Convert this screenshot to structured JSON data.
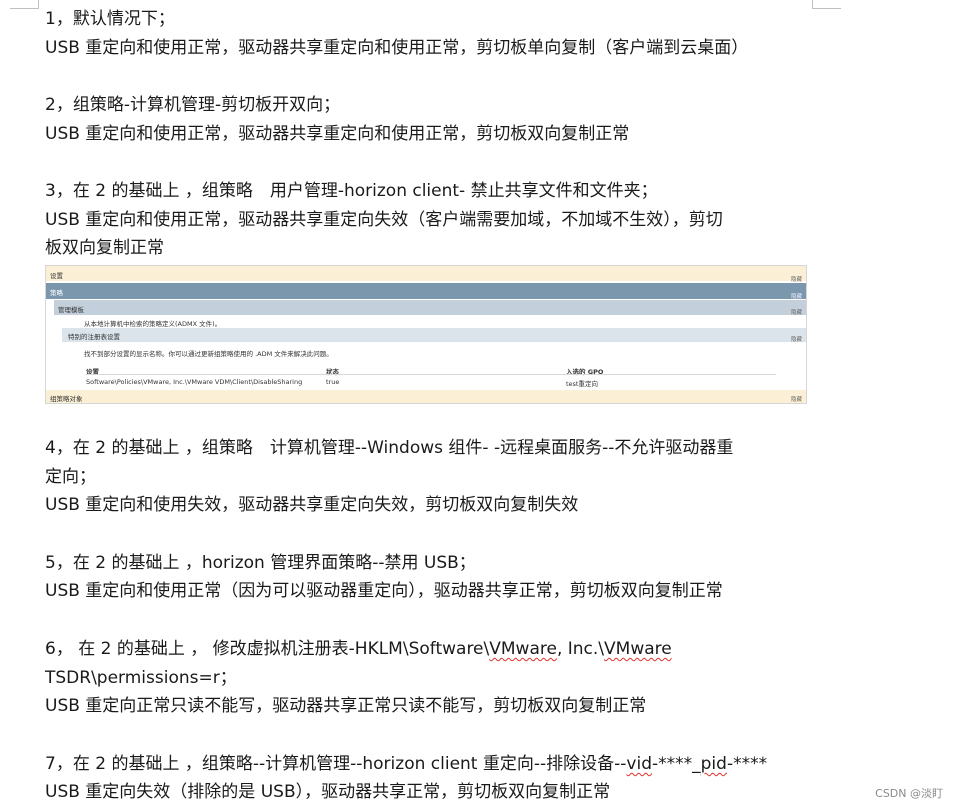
{
  "doc": {
    "items": [
      {
        "line": "1，默认情况下；",
        "detail": "USB 重定向和使用正常，驱动器共享重定向和使用正常，剪切板单向复制（客户端到云桌面）"
      },
      {
        "line": "2，组策略-计算机管理-剪切板开双向；",
        "detail": "USB 重定向和使用正常，驱动器共享重定向和使用正常，剪切板双向复制正常"
      },
      {
        "line": "3，在 2 的基础上 ，组策略　用户管理-horizon client-  禁止共享文件和文件夹；",
        "detail_l1": "USB 重定向和使用正常，驱动器共享重定向失效（客户端需要加域，不加域不生效），剪切",
        "detail_l2": "板双向复制正常"
      },
      {
        "line_l1": "4，在 2 的基础上 ，组策略　计算机管理--Windows 组件- -远程桌面服务--不允许驱动器重",
        "line_l2": "定向；",
        "detail": "USB 重定向和使用失效，驱动器共享重定向失效，剪切板双向复制失效"
      },
      {
        "line": "5，在 2 的基础上 ，horizon 管理界面策略--禁用 USB；",
        "detail": "USB 重定向和使用正常（因为可以驱动器重定向），驱动器共享正常，剪切板双向复制正常"
      },
      {
        "line_l1_a": "6， 在 2 的基础上 ， 修改虚拟机注册表-HKLM\\Software\\",
        "line_l1_b": "VMware",
        "line_l1_c": ", Inc.\\",
        "line_l1_d": "VMware",
        "line_l2": "TSDR\\permissions=r；",
        "detail": "USB 重定向正常只读不能写，驱动器共享正常只读不能写，剪切板双向复制正常"
      },
      {
        "line_a": "7，在 2 的基础上 ，组策略--计算机管理--horizon client 重定向--排除设备--",
        "line_b": "vid",
        "line_c": "-****_",
        "line_d": "pid",
        "line_e": "-****",
        "detail": "USB 重定向失效（排除的是 USB），驱动器共享正常，剪切板双向复制正常"
      }
    ]
  },
  "screenshot": {
    "settings": "设置",
    "policies": "策略",
    "admin_templates": "管理模板",
    "admx_note": "从本地计算机中检索的策略定义(ADMX 文件)。",
    "extra_registry": "特别的注册表设置",
    "extra_note": "找不到部分设置的显示名称。你可以通过更新组策略使用的 .ADM 文件来解决此问题。",
    "col_setting": "设置",
    "col_state": "状态",
    "col_gpo": "入选的 GPO",
    "row_setting": "Software\\Policies\\VMware, Inc.\\VMware VDM\\Client\\DisableSharing",
    "row_state": "true",
    "row_gpo": "test重定向",
    "gpo_objects": "组策略对象",
    "hide": "隐藏"
  },
  "watermark": "CSDN @淡盯"
}
